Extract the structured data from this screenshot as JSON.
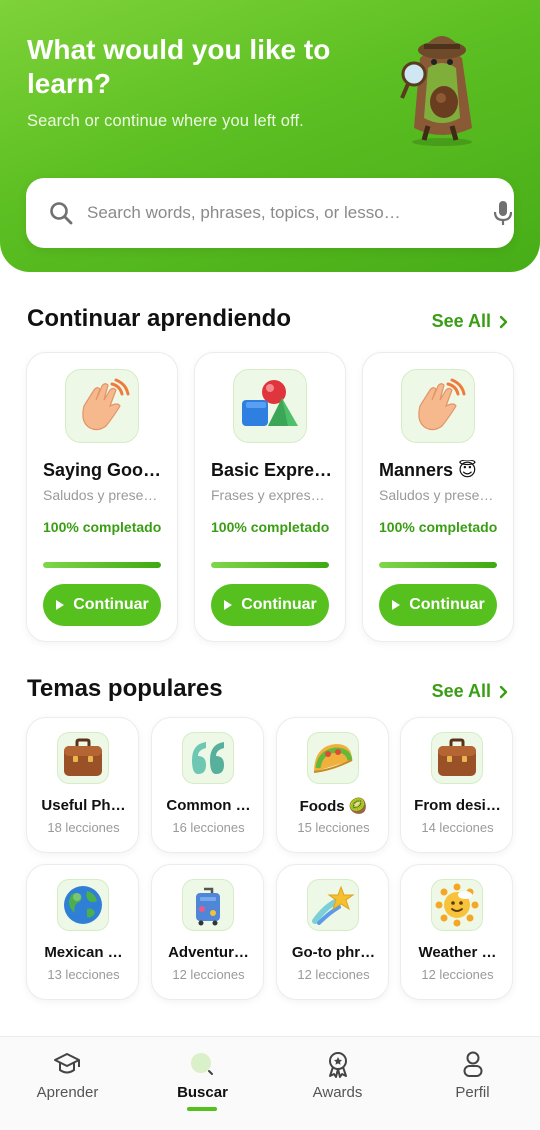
{
  "header": {
    "title": "What would you like to learn?",
    "subtitle": "Search or continue where you left off."
  },
  "search": {
    "placeholder": "Search words, phrases, topics, or lesso…",
    "value": ""
  },
  "continue_section": {
    "title": "Continuar aprendiendo",
    "see_all": "See All",
    "cards": [
      {
        "icon": "waving-hand-icon",
        "title": "Saying Goo…",
        "subtitle": "Saludos y prese…",
        "progress_text": "100% completado",
        "progress": 1.0,
        "button": "Continuar"
      },
      {
        "icon": "shapes-icon",
        "title": "Basic Expre…",
        "subtitle": "Frases y expres…",
        "progress_text": "100% completado",
        "progress": 1.0,
        "button": "Continuar"
      },
      {
        "icon": "waving-hand-icon",
        "title": "Manners 😇",
        "subtitle": "Saludos y prese…",
        "progress_text": "100% completado",
        "progress": 1.0,
        "button": "Continuar"
      }
    ]
  },
  "popular_section": {
    "title": "Temas populares",
    "see_all": "See All",
    "topics": [
      {
        "icon": "briefcase-icon",
        "title": "Useful Ph…",
        "count": "18 lecciones"
      },
      {
        "icon": "quote-icon",
        "title": "Common …",
        "count": "16 lecciones"
      },
      {
        "icon": "taco-icon",
        "title": "Foods 🥝",
        "count": "15 lecciones"
      },
      {
        "icon": "briefcase-icon",
        "title": "From desi…",
        "count": "14 lecciones"
      },
      {
        "icon": "globe-icon",
        "title": "Mexican …",
        "count": "13 lecciones"
      },
      {
        "icon": "luggage-icon",
        "title": "Adventur…",
        "count": "12 lecciones"
      },
      {
        "icon": "shooting-star-icon",
        "title": "Go-to phr…",
        "count": "12 lecciones"
      },
      {
        "icon": "sun-icon",
        "title": "Weather …",
        "count": "12 lecciones"
      }
    ]
  },
  "bottom_nav": {
    "items": [
      {
        "icon": "graduation-cap-icon",
        "label": "Aprender",
        "active": false
      },
      {
        "icon": "search-icon",
        "label": "Buscar",
        "active": true
      },
      {
        "icon": "award-icon",
        "label": "Awards",
        "active": false
      },
      {
        "icon": "person-icon",
        "label": "Perfil",
        "active": false
      }
    ]
  },
  "colors": {
    "brand_green": "#56c01f",
    "link_green": "#3a9e14",
    "header_gradient_start": "#7ed23a",
    "header_gradient_end": "#47ad18"
  }
}
